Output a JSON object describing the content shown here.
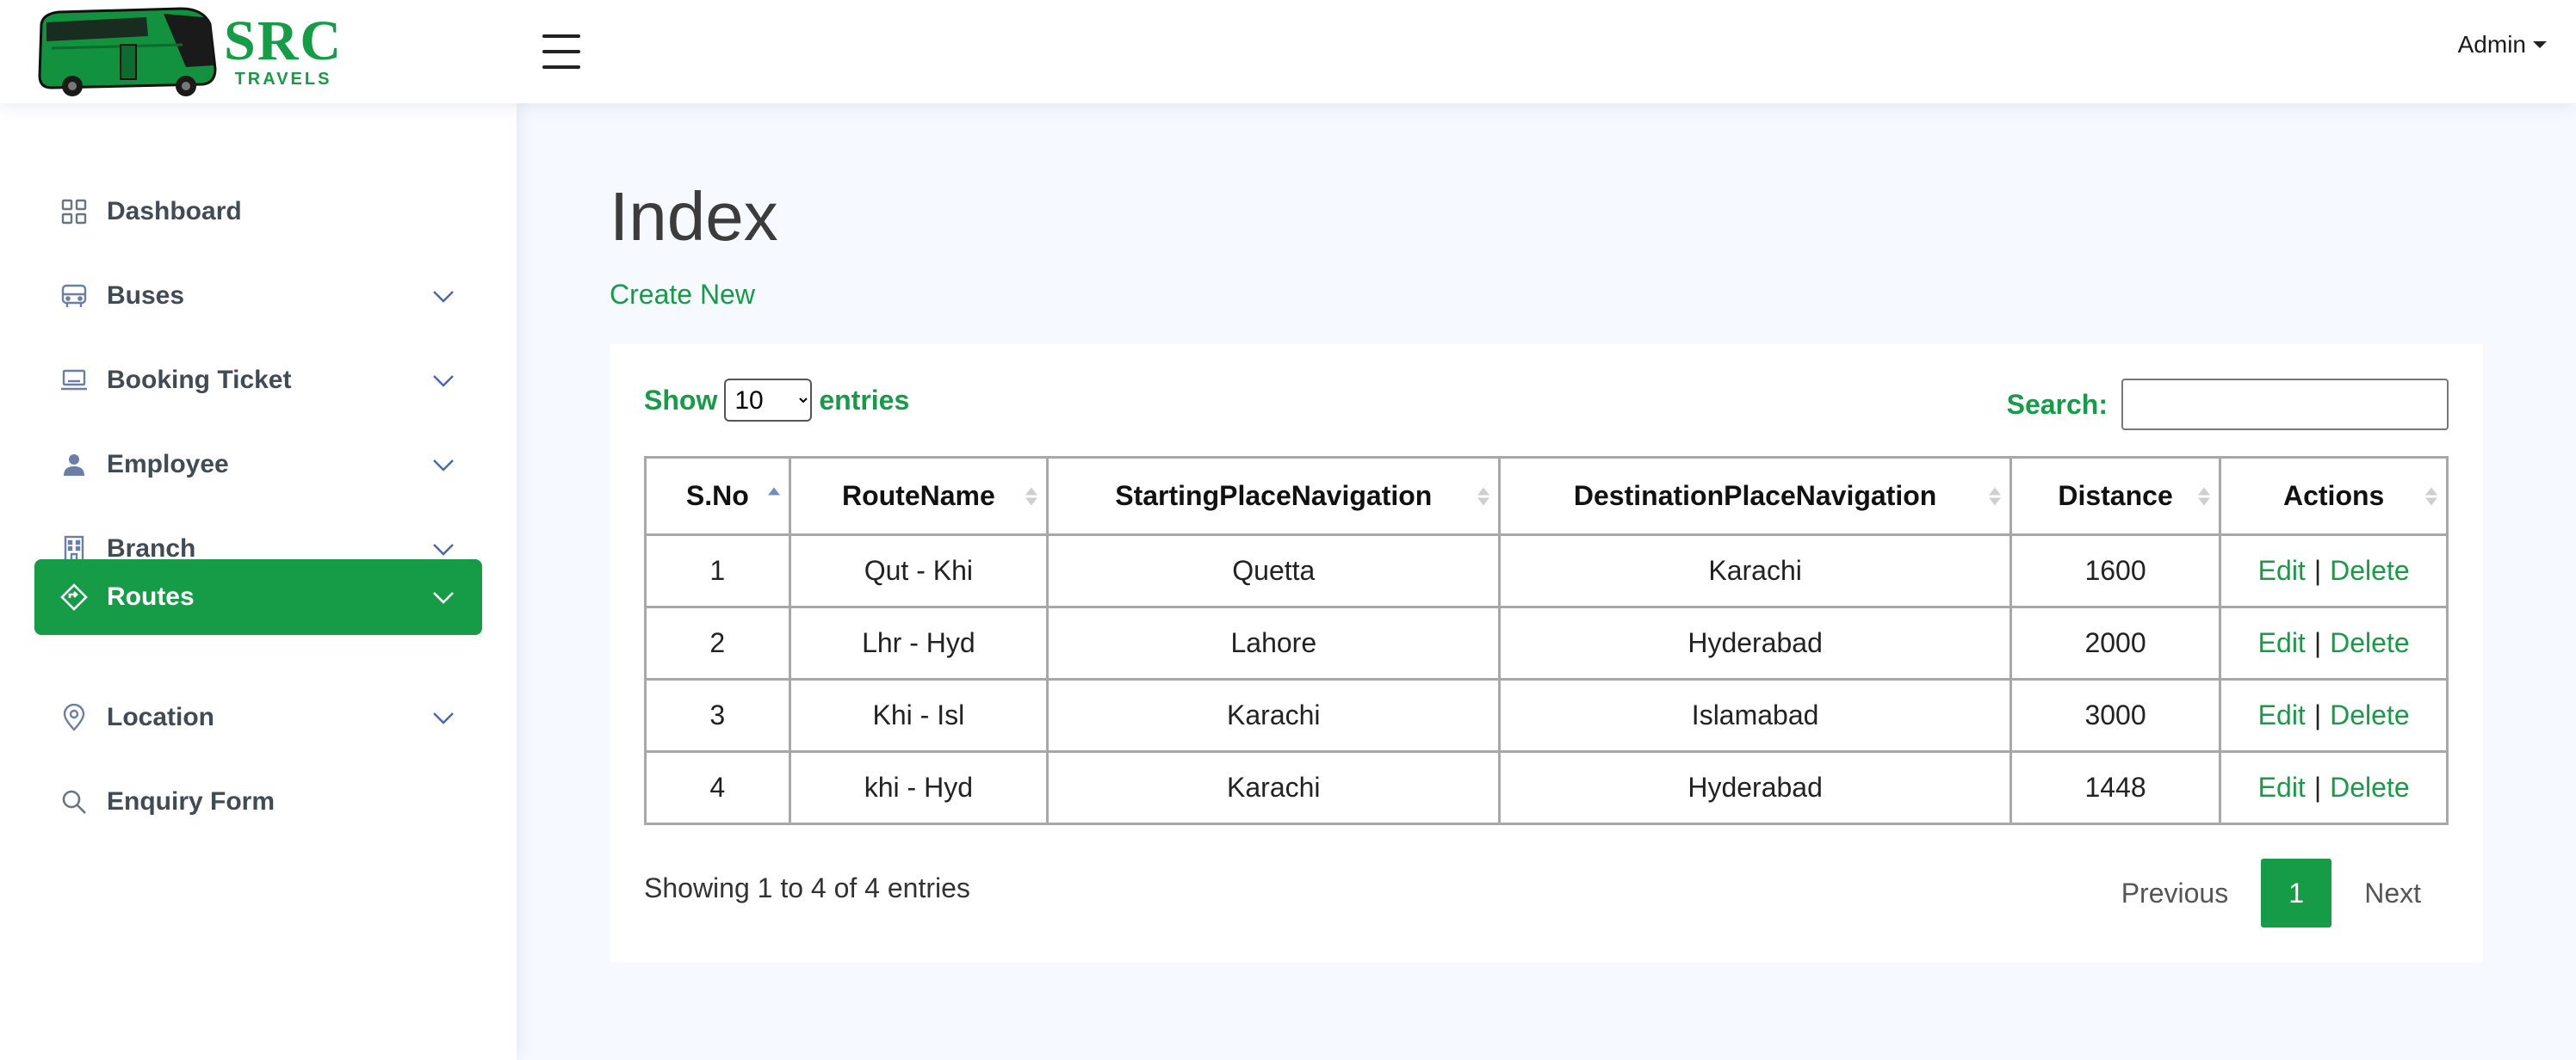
{
  "brand": {
    "title": "SRC",
    "subtitle": "TRAVELS",
    "color": "#169b47"
  },
  "header": {
    "user_menu_label": "Admin"
  },
  "sidebar": {
    "items": [
      {
        "label": "Dashboard",
        "icon": "grid-icon",
        "has_chevron": false,
        "active": false
      },
      {
        "label": "Buses",
        "icon": "bus-icon",
        "has_chevron": true,
        "active": false
      },
      {
        "label": "Booking Ticket",
        "icon": "laptop-icon",
        "has_chevron": true,
        "active": false
      },
      {
        "label": "Employee",
        "icon": "person-icon",
        "has_chevron": true,
        "active": false
      },
      {
        "label": "Branch",
        "icon": "building-icon",
        "has_chevron": true,
        "active": false
      },
      {
        "label": "Routes",
        "icon": "signpost-icon",
        "has_chevron": true,
        "active": true
      },
      {
        "label": "Location",
        "icon": "map-pin-icon",
        "has_chevron": true,
        "active": false
      },
      {
        "label": "Enquiry Form",
        "icon": "search-icon",
        "has_chevron": false,
        "active": false
      }
    ]
  },
  "main": {
    "title": "Index",
    "create_link": "Create New",
    "length_menu": {
      "prefix": "Show",
      "selected": "10",
      "suffix": "entries"
    },
    "search": {
      "label": "Search:",
      "value": ""
    },
    "table": {
      "columns": [
        "S.No",
        "RouteName",
        "StartingPlaceNavigation",
        "DestinationPlaceNavigation",
        "Distance",
        "Actions"
      ],
      "sorted_column": "S.No",
      "rows": [
        {
          "sno": "1",
          "route": "Qut - Khi",
          "start": "Quetta",
          "dest": "Karachi",
          "distance": "1600",
          "edit": "Edit",
          "sep": "|",
          "delete": "Delete"
        },
        {
          "sno": "2",
          "route": "Lhr - Hyd",
          "start": "Lahore",
          "dest": "Hyderabad",
          "distance": "2000",
          "edit": "Edit",
          "sep": "|",
          "delete": "Delete"
        },
        {
          "sno": "3",
          "route": "Khi - Isl",
          "start": "Karachi",
          "dest": "Islamabad",
          "distance": "3000",
          "edit": "Edit",
          "sep": "|",
          "delete": "Delete"
        },
        {
          "sno": "4",
          "route": "khi - Hyd",
          "start": "Karachi",
          "dest": "Hyderabad",
          "distance": "1448",
          "edit": "Edit",
          "sep": "|",
          "delete": "Delete"
        }
      ]
    },
    "info": "Showing 1 to 4 of 4 entries",
    "pagination": {
      "previous": "Previous",
      "current": "1",
      "next": "Next"
    }
  }
}
